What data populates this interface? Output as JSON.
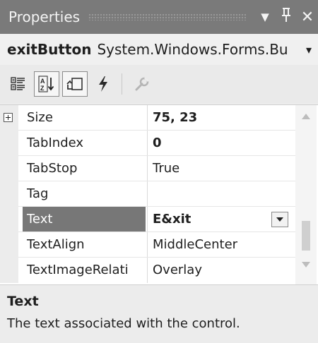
{
  "window": {
    "title": "Properties",
    "buttons": {
      "dropdown": "▼",
      "pin": "ꟼ",
      "close": "✕"
    }
  },
  "object_selector": {
    "name": "exitButton",
    "type": "System.Windows.Forms.Bu",
    "arrow": "▾"
  },
  "toolbar": {
    "tools": [
      {
        "icon": "categorized-icon",
        "active": false
      },
      {
        "icon": "alphabetical-icon",
        "active": true
      },
      {
        "icon": "properties-icon",
        "active": true
      },
      {
        "icon": "events-icon",
        "active": false
      },
      {
        "icon": "property-pages-icon",
        "active": false
      }
    ]
  },
  "properties": [
    {
      "name": "Size",
      "value": "75, 23",
      "bold": true,
      "expandable": true,
      "selected": false
    },
    {
      "name": "TabIndex",
      "value": "0",
      "bold": true,
      "expandable": false,
      "selected": false
    },
    {
      "name": "TabStop",
      "value": "True",
      "bold": false,
      "expandable": false,
      "selected": false
    },
    {
      "name": "Tag",
      "value": "",
      "bold": false,
      "expandable": false,
      "selected": false
    },
    {
      "name": "Text",
      "value": "E&xit",
      "bold": true,
      "expandable": false,
      "selected": true
    },
    {
      "name": "TextAlign",
      "value": "MiddleCenter",
      "bold": false,
      "expandable": false,
      "selected": false
    },
    {
      "name": "TextImageRelati",
      "value": "Overlay",
      "bold": false,
      "expandable": false,
      "selected": false
    }
  ],
  "description": {
    "title": "Text",
    "text": "The text associated with the control."
  }
}
